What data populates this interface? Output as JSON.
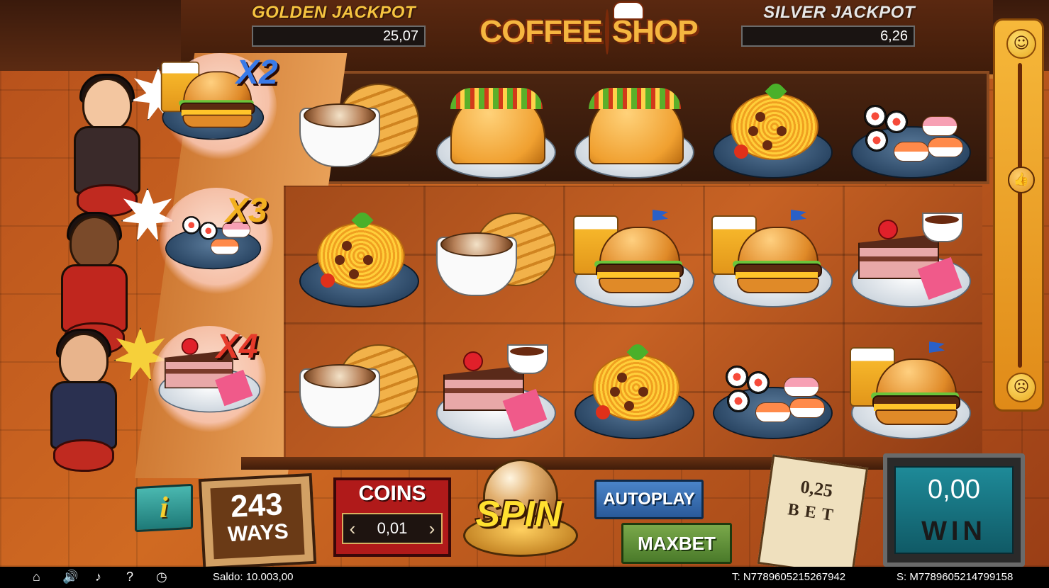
{
  "jackpots": {
    "golden": {
      "title": "GOLDEN JACKPOT",
      "value": "25,07"
    },
    "silver": {
      "title": "SILVER JACKPOT",
      "value": "6,26"
    }
  },
  "logo": {
    "left": "COFFEE",
    "right": "SHOP"
  },
  "orders": [
    {
      "multiplier": "X2",
      "dish": "burger-beer",
      "mood_icon": "angry"
    },
    {
      "multiplier": "X3",
      "dish": "sushi",
      "mood_icon": "angry"
    },
    {
      "multiplier": "X4",
      "dish": "cake",
      "mood_icon": "zap"
    }
  ],
  "reels": {
    "rows": [
      [
        "coffee-croissant",
        "taco",
        "taco",
        "spaghetti",
        "sushi"
      ],
      [
        "spaghetti",
        "coffee-croissant",
        "burger-beer",
        "burger-beer",
        "cake"
      ],
      [
        "coffee-croissant",
        "cake",
        "spaghetti",
        "sushi",
        "burger-beer"
      ]
    ]
  },
  "controls": {
    "info_label": "i",
    "ways_number": "243",
    "ways_label": "WAYS",
    "coins_title": "COINS",
    "coin_value": "0,01",
    "coin_prev": "‹",
    "coin_next": "›",
    "spin_label": "SPIN",
    "autoplay_label": "AUTOPLAY",
    "maxbet_label": "MAXBET",
    "bet_value": "0,25",
    "bet_label": "BET",
    "win_value": "0,00",
    "win_label": "WIN"
  },
  "mood_meter": {
    "top_icon": "happy-face",
    "bottom_icon": "sad-face",
    "thumb_icon": "thumbs-up",
    "level": 0.62
  },
  "footer": {
    "home_icon": "⌂",
    "sound_icon": "🔊",
    "music_icon": "♪",
    "help_icon": "?",
    "clock_icon": "◷",
    "saldo": "Saldo: 10.003,00",
    "t_id": "T:  N7789605215267942",
    "s_id": "S:  M7789605214799158"
  },
  "colors": {
    "golden": "#f6c440",
    "silver": "#e7e7e7",
    "x2": "#3a7ae8",
    "x3": "#f2b020",
    "x4": "#e63a2a",
    "autoplay": "#3a70b4",
    "maxbet": "#6a9a3a",
    "coins": "#b01a1a",
    "win_screen": "#1e8a98"
  }
}
